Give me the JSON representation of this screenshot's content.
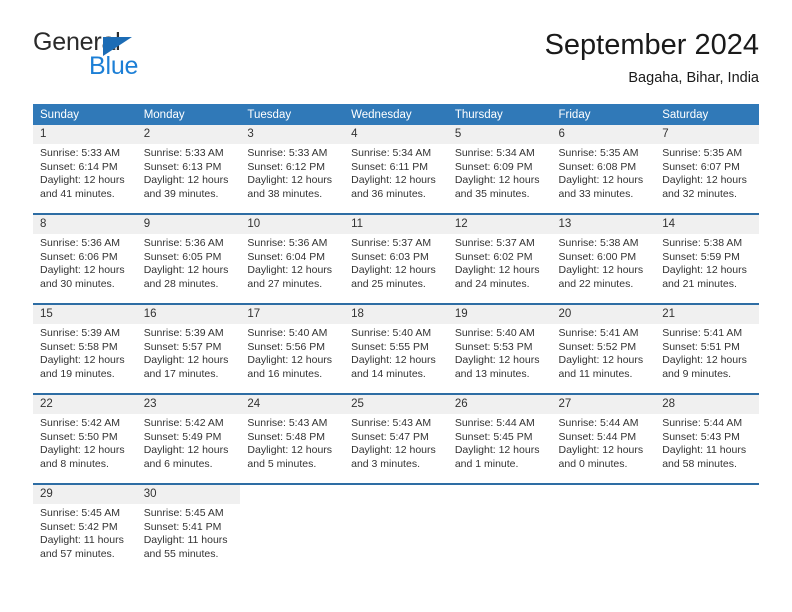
{
  "brand": {
    "word_one": "General",
    "word_two": "Blue",
    "triangle_icon": "brand-triangle-icon",
    "colors": {
      "general": "#2b2b2b",
      "blue": "#1c7fd6",
      "triangle": "#1c6cb5"
    }
  },
  "header": {
    "title": "September 2024",
    "subtitle": "Bagaha, Bihar, India"
  },
  "colors": {
    "header_blue": "#3079b8",
    "row_separator": "#2e6da4",
    "daynum_band": "#f0f0f0",
    "text": "#333333"
  },
  "weekday_headers": [
    "Sunday",
    "Monday",
    "Tuesday",
    "Wednesday",
    "Thursday",
    "Friday",
    "Saturday"
  ],
  "weeks": [
    [
      {
        "day": "1",
        "sunrise": "Sunrise: 5:33 AM",
        "sunset": "Sunset: 6:14 PM",
        "daylight": "Daylight: 12 hours and 41 minutes."
      },
      {
        "day": "2",
        "sunrise": "Sunrise: 5:33 AM",
        "sunset": "Sunset: 6:13 PM",
        "daylight": "Daylight: 12 hours and 39 minutes."
      },
      {
        "day": "3",
        "sunrise": "Sunrise: 5:33 AM",
        "sunset": "Sunset: 6:12 PM",
        "daylight": "Daylight: 12 hours and 38 minutes."
      },
      {
        "day": "4",
        "sunrise": "Sunrise: 5:34 AM",
        "sunset": "Sunset: 6:11 PM",
        "daylight": "Daylight: 12 hours and 36 minutes."
      },
      {
        "day": "5",
        "sunrise": "Sunrise: 5:34 AM",
        "sunset": "Sunset: 6:09 PM",
        "daylight": "Daylight: 12 hours and 35 minutes."
      },
      {
        "day": "6",
        "sunrise": "Sunrise: 5:35 AM",
        "sunset": "Sunset: 6:08 PM",
        "daylight": "Daylight: 12 hours and 33 minutes."
      },
      {
        "day": "7",
        "sunrise": "Sunrise: 5:35 AM",
        "sunset": "Sunset: 6:07 PM",
        "daylight": "Daylight: 12 hours and 32 minutes."
      }
    ],
    [
      {
        "day": "8",
        "sunrise": "Sunrise: 5:36 AM",
        "sunset": "Sunset: 6:06 PM",
        "daylight": "Daylight: 12 hours and 30 minutes."
      },
      {
        "day": "9",
        "sunrise": "Sunrise: 5:36 AM",
        "sunset": "Sunset: 6:05 PM",
        "daylight": "Daylight: 12 hours and 28 minutes."
      },
      {
        "day": "10",
        "sunrise": "Sunrise: 5:36 AM",
        "sunset": "Sunset: 6:04 PM",
        "daylight": "Daylight: 12 hours and 27 minutes."
      },
      {
        "day": "11",
        "sunrise": "Sunrise: 5:37 AM",
        "sunset": "Sunset: 6:03 PM",
        "daylight": "Daylight: 12 hours and 25 minutes."
      },
      {
        "day": "12",
        "sunrise": "Sunrise: 5:37 AM",
        "sunset": "Sunset: 6:02 PM",
        "daylight": "Daylight: 12 hours and 24 minutes."
      },
      {
        "day": "13",
        "sunrise": "Sunrise: 5:38 AM",
        "sunset": "Sunset: 6:00 PM",
        "daylight": "Daylight: 12 hours and 22 minutes."
      },
      {
        "day": "14",
        "sunrise": "Sunrise: 5:38 AM",
        "sunset": "Sunset: 5:59 PM",
        "daylight": "Daylight: 12 hours and 21 minutes."
      }
    ],
    [
      {
        "day": "15",
        "sunrise": "Sunrise: 5:39 AM",
        "sunset": "Sunset: 5:58 PM",
        "daylight": "Daylight: 12 hours and 19 minutes."
      },
      {
        "day": "16",
        "sunrise": "Sunrise: 5:39 AM",
        "sunset": "Sunset: 5:57 PM",
        "daylight": "Daylight: 12 hours and 17 minutes."
      },
      {
        "day": "17",
        "sunrise": "Sunrise: 5:40 AM",
        "sunset": "Sunset: 5:56 PM",
        "daylight": "Daylight: 12 hours and 16 minutes."
      },
      {
        "day": "18",
        "sunrise": "Sunrise: 5:40 AM",
        "sunset": "Sunset: 5:55 PM",
        "daylight": "Daylight: 12 hours and 14 minutes."
      },
      {
        "day": "19",
        "sunrise": "Sunrise: 5:40 AM",
        "sunset": "Sunset: 5:53 PM",
        "daylight": "Daylight: 12 hours and 13 minutes."
      },
      {
        "day": "20",
        "sunrise": "Sunrise: 5:41 AM",
        "sunset": "Sunset: 5:52 PM",
        "daylight": "Daylight: 12 hours and 11 minutes."
      },
      {
        "day": "21",
        "sunrise": "Sunrise: 5:41 AM",
        "sunset": "Sunset: 5:51 PM",
        "daylight": "Daylight: 12 hours and 9 minutes."
      }
    ],
    [
      {
        "day": "22",
        "sunrise": "Sunrise: 5:42 AM",
        "sunset": "Sunset: 5:50 PM",
        "daylight": "Daylight: 12 hours and 8 minutes."
      },
      {
        "day": "23",
        "sunrise": "Sunrise: 5:42 AM",
        "sunset": "Sunset: 5:49 PM",
        "daylight": "Daylight: 12 hours and 6 minutes."
      },
      {
        "day": "24",
        "sunrise": "Sunrise: 5:43 AM",
        "sunset": "Sunset: 5:48 PM",
        "daylight": "Daylight: 12 hours and 5 minutes."
      },
      {
        "day": "25",
        "sunrise": "Sunrise: 5:43 AM",
        "sunset": "Sunset: 5:47 PM",
        "daylight": "Daylight: 12 hours and 3 minutes."
      },
      {
        "day": "26",
        "sunrise": "Sunrise: 5:44 AM",
        "sunset": "Sunset: 5:45 PM",
        "daylight": "Daylight: 12 hours and 1 minute."
      },
      {
        "day": "27",
        "sunrise": "Sunrise: 5:44 AM",
        "sunset": "Sunset: 5:44 PM",
        "daylight": "Daylight: 12 hours and 0 minutes."
      },
      {
        "day": "28",
        "sunrise": "Sunrise: 5:44 AM",
        "sunset": "Sunset: 5:43 PM",
        "daylight": "Daylight: 11 hours and 58 minutes."
      }
    ],
    [
      {
        "day": "29",
        "sunrise": "Sunrise: 5:45 AM",
        "sunset": "Sunset: 5:42 PM",
        "daylight": "Daylight: 11 hours and 57 minutes."
      },
      {
        "day": "30",
        "sunrise": "Sunrise: 5:45 AM",
        "sunset": "Sunset: 5:41 PM",
        "daylight": "Daylight: 11 hours and 55 minutes."
      },
      {
        "day": "",
        "sunrise": "",
        "sunset": "",
        "daylight": ""
      },
      {
        "day": "",
        "sunrise": "",
        "sunset": "",
        "daylight": ""
      },
      {
        "day": "",
        "sunrise": "",
        "sunset": "",
        "daylight": ""
      },
      {
        "day": "",
        "sunrise": "",
        "sunset": "",
        "daylight": ""
      },
      {
        "day": "",
        "sunrise": "",
        "sunset": "",
        "daylight": ""
      }
    ]
  ]
}
